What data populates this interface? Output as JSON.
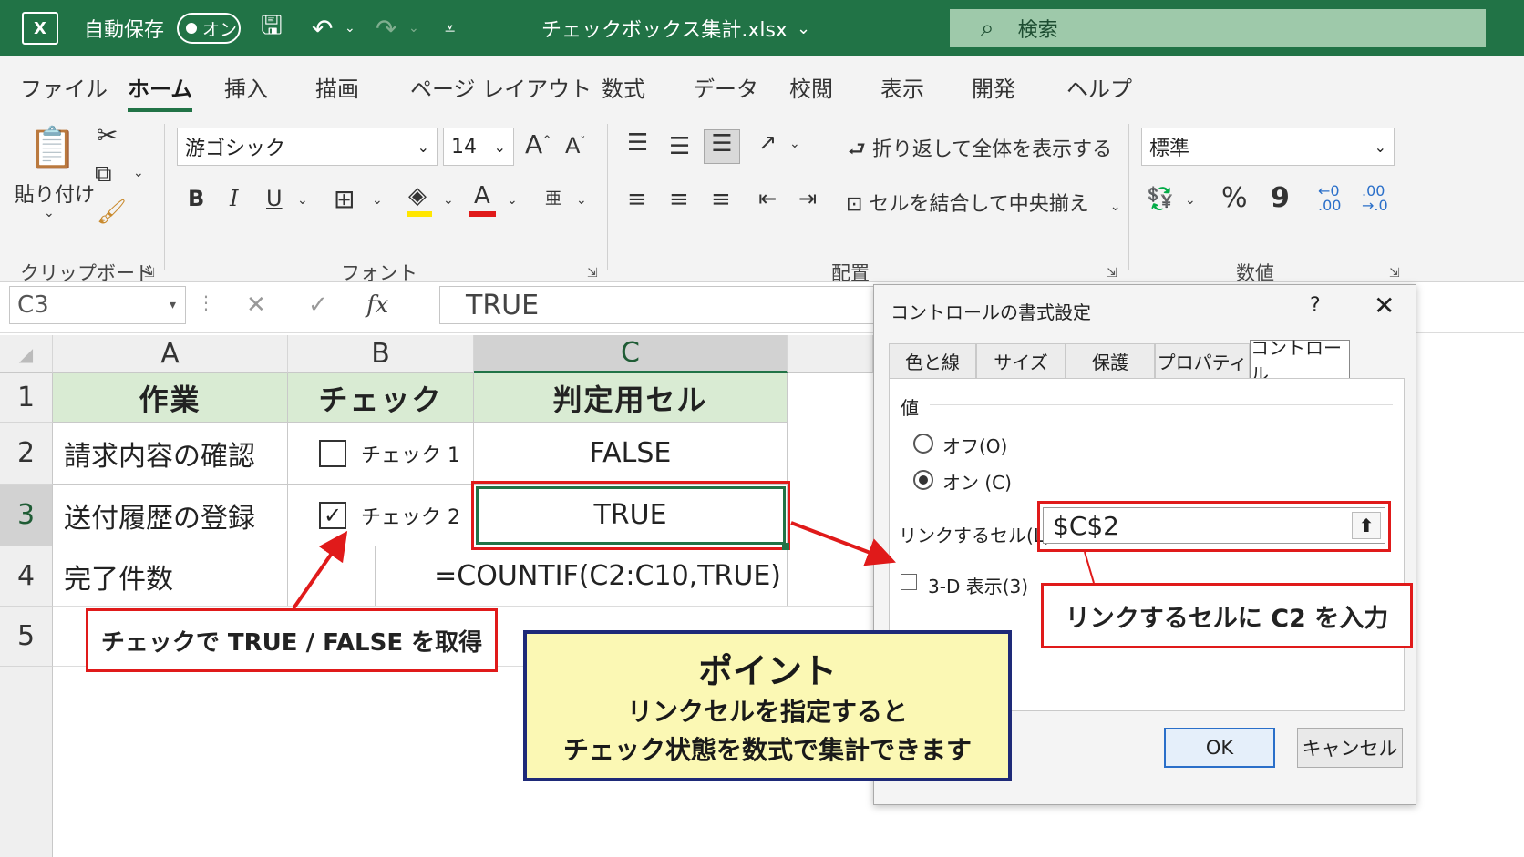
{
  "titlebar": {
    "logo": "X",
    "autosave_label": "自動保存",
    "autosave_state": "オン",
    "filename": "チェックボックス集計.xlsx",
    "search_placeholder": "検索"
  },
  "ribbon_tabs": [
    "ファイル",
    "ホーム",
    "挿入",
    "描画",
    "ページ レイアウト",
    "数式",
    "データ",
    "校閲",
    "表示",
    "開発",
    "ヘルプ"
  ],
  "active_tab": "ホーム",
  "ribbon": {
    "paste_label": "貼り付け",
    "clipboard_label": "クリップボード",
    "font_name": "游ゴシック",
    "font_size": "14",
    "grow_font": "A",
    "shrink_font": "A",
    "bold": "B",
    "italic": "I",
    "underline": "U",
    "font_color_letter": "A",
    "font_group_label": "フォント",
    "wrap_text": "折り返して全体を表示する",
    "merge_center": "セルを結合して中央揃え",
    "alignment_group_label": "配置",
    "number_format": "標準",
    "percent": "%",
    "comma": "9",
    "number_group_label": "数値",
    "colors": {
      "highlight": "#ffe600",
      "font_color": "#e01a1a"
    }
  },
  "formula_bar": {
    "name_box": "C3",
    "cancel": "✕",
    "enter": "✓",
    "fx": "fx",
    "formula": "TRUE"
  },
  "sheet": {
    "columns": [
      "A",
      "B",
      "C"
    ],
    "selected_column": "C",
    "rows": [
      "1",
      "2",
      "3",
      "4",
      "5"
    ],
    "selected_row": "3",
    "headers": {
      "a": "作業",
      "b": "チェック",
      "c": "判定用セル"
    },
    "row2": {
      "a": "請求内容の確認",
      "checkbox_label": "チェック 1",
      "checked": false,
      "c": "FALSE"
    },
    "row3": {
      "a": "送付履歴の登録",
      "checkbox_label": "チェック 2",
      "checked": true,
      "c": "TRUE"
    },
    "row4": {
      "a": "完了件数",
      "formula": "=COUNTIF(C2:C10,TRUE)"
    },
    "header_fill": "#d9ebd3"
  },
  "dialog": {
    "title": "コントロールの書式設定",
    "help": "?",
    "close": "✕",
    "tabs": [
      "色と線",
      "サイズ",
      "保護",
      "プロパティ",
      "コントロール"
    ],
    "active_tab": "コントロール",
    "value_section": "値",
    "option_off": "オフ(O)",
    "option_on": "オン (C)",
    "selected_option": "オン (C)",
    "link_cell_label": "リンクするセル(L):",
    "link_cell_value": "$C$2",
    "three_d": "3-D 表示(3)",
    "ok": "OK",
    "cancel": "キャンセル"
  },
  "annotations": {
    "checkbox_callout": "チェックで TRUE / FALSE を取得",
    "link_callout": "リンクするセルに C2 を入力",
    "point_title": "ポイント",
    "point_line1": "リンクセルを指定すると",
    "point_line2": "チェック状態を数式で集計できます",
    "accent_red": "#e01a1a",
    "point_fill": "#fbf8b4",
    "point_border": "#1e2a78"
  }
}
